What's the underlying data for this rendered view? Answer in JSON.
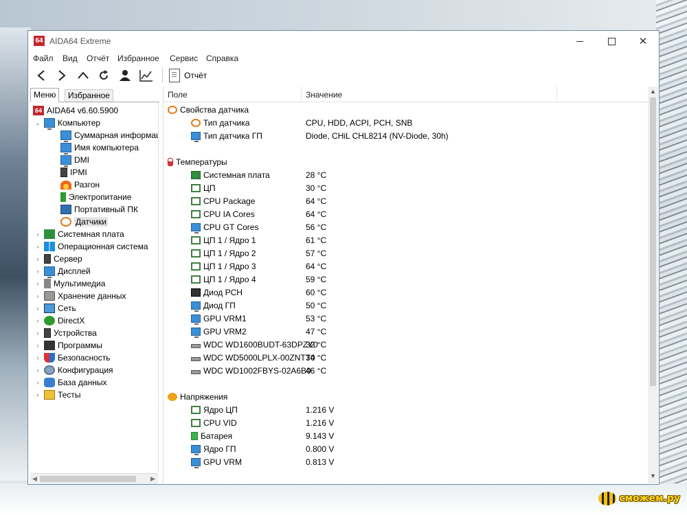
{
  "window": {
    "title": "AIDA64 Extreme",
    "logo_text": "64"
  },
  "menubar": {
    "items": [
      "Файл",
      "Вид",
      "Отчёт",
      "Избранное",
      "Сервис",
      "Справка"
    ]
  },
  "toolbar": {
    "icons": [
      "back-icon",
      "forward-icon",
      "up-icon",
      "refresh-icon",
      "user-icon",
      "chart-icon"
    ],
    "report_label": "Отчёт"
  },
  "left_tabs": {
    "menu": "Меню",
    "favorites": "Избранное"
  },
  "tree": {
    "root": "AIDA64 v6.60.5900",
    "computer": "Компьютер",
    "computer_children": [
      "Суммарная информация",
      "Имя компьютера",
      "DMI",
      "IPMI",
      "Разгон",
      "Электропитание",
      "Портативный ПК",
      "Датчики"
    ],
    "categories": [
      "Системная плата",
      "Операционная система",
      "Сервер",
      "Дисплей",
      "Мультимедиа",
      "Хранение данных",
      "Сеть",
      "DirectX",
      "Устройства",
      "Программы",
      "Безопасность",
      "Конфигурация",
      "База данных",
      "Тесты"
    ],
    "selected": "Датчики"
  },
  "table": {
    "col_field": "Поле",
    "col_value": "Значение",
    "groups": [
      {
        "name": "Свойства датчика",
        "icon": "gauge-icon",
        "rows": [
          {
            "field": "Тип датчика",
            "value": "CPU, HDD, ACPI, PCH, SNB",
            "icon": "gauge-icon"
          },
          {
            "field": "Тип датчика ГП",
            "value": "Diode, CHiL CHL8214  (NV-Diode, 30h)",
            "icon": "monitor-icon"
          }
        ]
      },
      {
        "name": "Температуры",
        "icon": "thermometer-icon",
        "rows": [
          {
            "field": "Системная плата",
            "value": "28 °C",
            "icon": "motherboard-icon"
          },
          {
            "field": "ЦП",
            "value": "30 °C",
            "icon": "chip-icon"
          },
          {
            "field": "CPU Package",
            "value": "64 °C",
            "icon": "chip-icon"
          },
          {
            "field": "CPU IA Cores",
            "value": "64 °C",
            "icon": "chip-icon"
          },
          {
            "field": "CPU GT Cores",
            "value": "56 °C",
            "icon": "monitor-icon"
          },
          {
            "field": "ЦП 1 / Ядро 1",
            "value": "61 °C",
            "icon": "chip-icon"
          },
          {
            "field": "ЦП 1 / Ядро 2",
            "value": "57 °C",
            "icon": "chip-icon"
          },
          {
            "field": "ЦП 1 / Ядро 3",
            "value": "64 °C",
            "icon": "chip-icon"
          },
          {
            "field": "ЦП 1 / Ядро 4",
            "value": "59 °C",
            "icon": "chip-icon"
          },
          {
            "field": "Диод PCH",
            "value": "60 °C",
            "icon": "pch-icon"
          },
          {
            "field": "Диод ГП",
            "value": "50 °C",
            "icon": "monitor-icon"
          },
          {
            "field": "GPU VRM1",
            "value": "53 °C",
            "icon": "monitor-icon"
          },
          {
            "field": "GPU VRM2",
            "value": "47 °C",
            "icon": "monitor-icon"
          },
          {
            "field": "WDC WD1600BUDT-63DPZY0",
            "value": "32 °C",
            "icon": "hdd-icon"
          },
          {
            "field": "WDC WD5000LPLX-00ZNTT0",
            "value": "34 °C",
            "icon": "hdd-icon"
          },
          {
            "field": "WDC WD1002FBYS-02A6B0",
            "value": "46 °C",
            "icon": "hdd-icon"
          }
        ]
      },
      {
        "name": "Напряжения",
        "icon": "voltage-icon",
        "rows": [
          {
            "field": "Ядро ЦП",
            "value": "1.216 V",
            "icon": "chip-icon"
          },
          {
            "field": "CPU VID",
            "value": "1.216 V",
            "icon": "chip-icon"
          },
          {
            "field": "Батарея",
            "value": "9.143 V",
            "icon": "battery-icon"
          },
          {
            "field": "Ядро ГП",
            "value": "0.800 V",
            "icon": "monitor-icon"
          },
          {
            "field": "GPU VRM",
            "value": "0.813 V",
            "icon": "monitor-icon"
          }
        ]
      }
    ]
  },
  "watermark": {
    "text": "сможем.ру"
  }
}
